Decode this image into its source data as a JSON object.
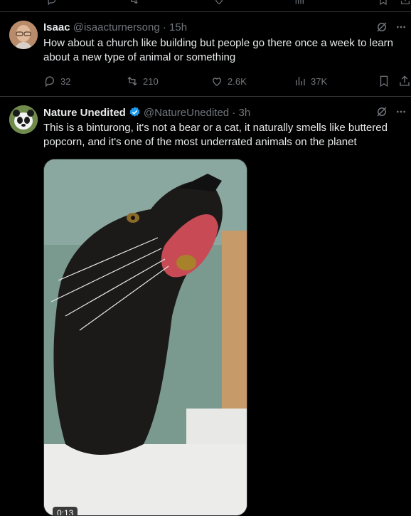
{
  "tweets": [
    {
      "name": "Isaac",
      "handle": "@isaacturnersong",
      "dot": "·",
      "time": "15h",
      "text": "How about  a church like building but people go there once a week to learn about a new type of animal or something",
      "replies": "32",
      "retweets": "210",
      "likes": "2.6K",
      "views": "37K"
    },
    {
      "name": "Nature Unedited",
      "handle": "@NatureUnedited",
      "dot": "·",
      "time": "3h",
      "text": "This is a binturong, it's not a bear or a cat, it naturally smells like buttered popcorn, and it's one of the most underrated animals on the planet",
      "video_duration": "0:13"
    }
  ],
  "colors": {
    "verified": "#1d9bf0",
    "border": "#2f3336",
    "muted": "#71767b",
    "text": "#e7e9ea"
  }
}
